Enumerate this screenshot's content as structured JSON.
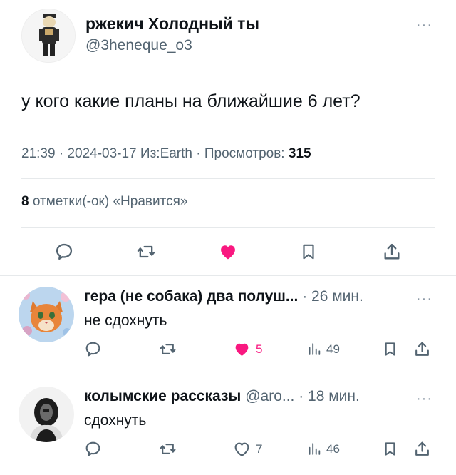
{
  "tweet": {
    "author_name": "ржекич Холодный ты",
    "author_handle": "@3heneque_o3",
    "text": "у кого какие планы на ближайшие 6 лет?",
    "time": "21:39",
    "date": "2024-03-17",
    "source": "Из:Earth",
    "views_label": "Просмотров:",
    "views_count": "315",
    "likes_count": "8",
    "likes_label": "отметки(-ок) «Нравится»",
    "more_label": "···"
  },
  "actions": {
    "icons": [
      "reply-icon",
      "retweet-icon",
      "like-icon-filled",
      "bookmark-icon",
      "share-icon"
    ],
    "like_color": "#f91880"
  },
  "replies": [
    {
      "name": "гера (не собака) два полуш...",
      "meta": "· 26 мин.",
      "text": "не сдохнуть",
      "likes": "5",
      "liked": true,
      "views": "49",
      "more_label": "···"
    },
    {
      "name": "колымские рассказы",
      "meta": "@aro... · 18 мин.",
      "text": "сдохнуть",
      "likes": "7",
      "liked": false,
      "views": "46",
      "more_label": "···"
    }
  ],
  "colors": {
    "text_primary": "#0f1419",
    "text_secondary": "#536471",
    "divider": "#e6e9eb",
    "like_pink": "#f91880"
  }
}
